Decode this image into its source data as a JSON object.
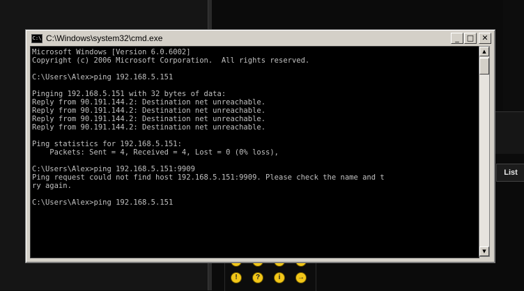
{
  "window": {
    "title": "C:\\Windows\\system32\\cmd.exe",
    "icon_label": "C:\\",
    "buttons": {
      "minimize": "_",
      "maximize": "□",
      "close": "✕"
    }
  },
  "console": {
    "lines": [
      "Microsoft Windows [Version 6.0.6002]",
      "Copyright (c) 2006 Microsoft Corporation.  All rights reserved.",
      "",
      "C:\\Users\\Alex>ping 192.168.5.151",
      "",
      "Pinging 192.168.5.151 with 32 bytes of data:",
      "Reply from 90.191.144.2: Destination net unreachable.",
      "Reply from 90.191.144.2: Destination net unreachable.",
      "Reply from 90.191.144.2: Destination net unreachable.",
      "Reply from 90.191.144.2: Destination net unreachable.",
      "",
      "Ping statistics for 192.168.5.151:",
      "    Packets: Sent = 4, Received = 4, Lost = 0 (0% loss),",
      "",
      "C:\\Users\\Alex>ping 192.168.5.151:9909",
      "Ping request could not find host 192.168.5.151:9909. Please check the name and t",
      "ry again.",
      "",
      "C:\\Users\\Alex>ping 192.168.5.151"
    ]
  },
  "scrollbar": {
    "up": "▲",
    "down": "▼"
  },
  "background": {
    "list_tab": "List",
    "icons": [
      "!",
      "?",
      "i",
      "→"
    ]
  }
}
